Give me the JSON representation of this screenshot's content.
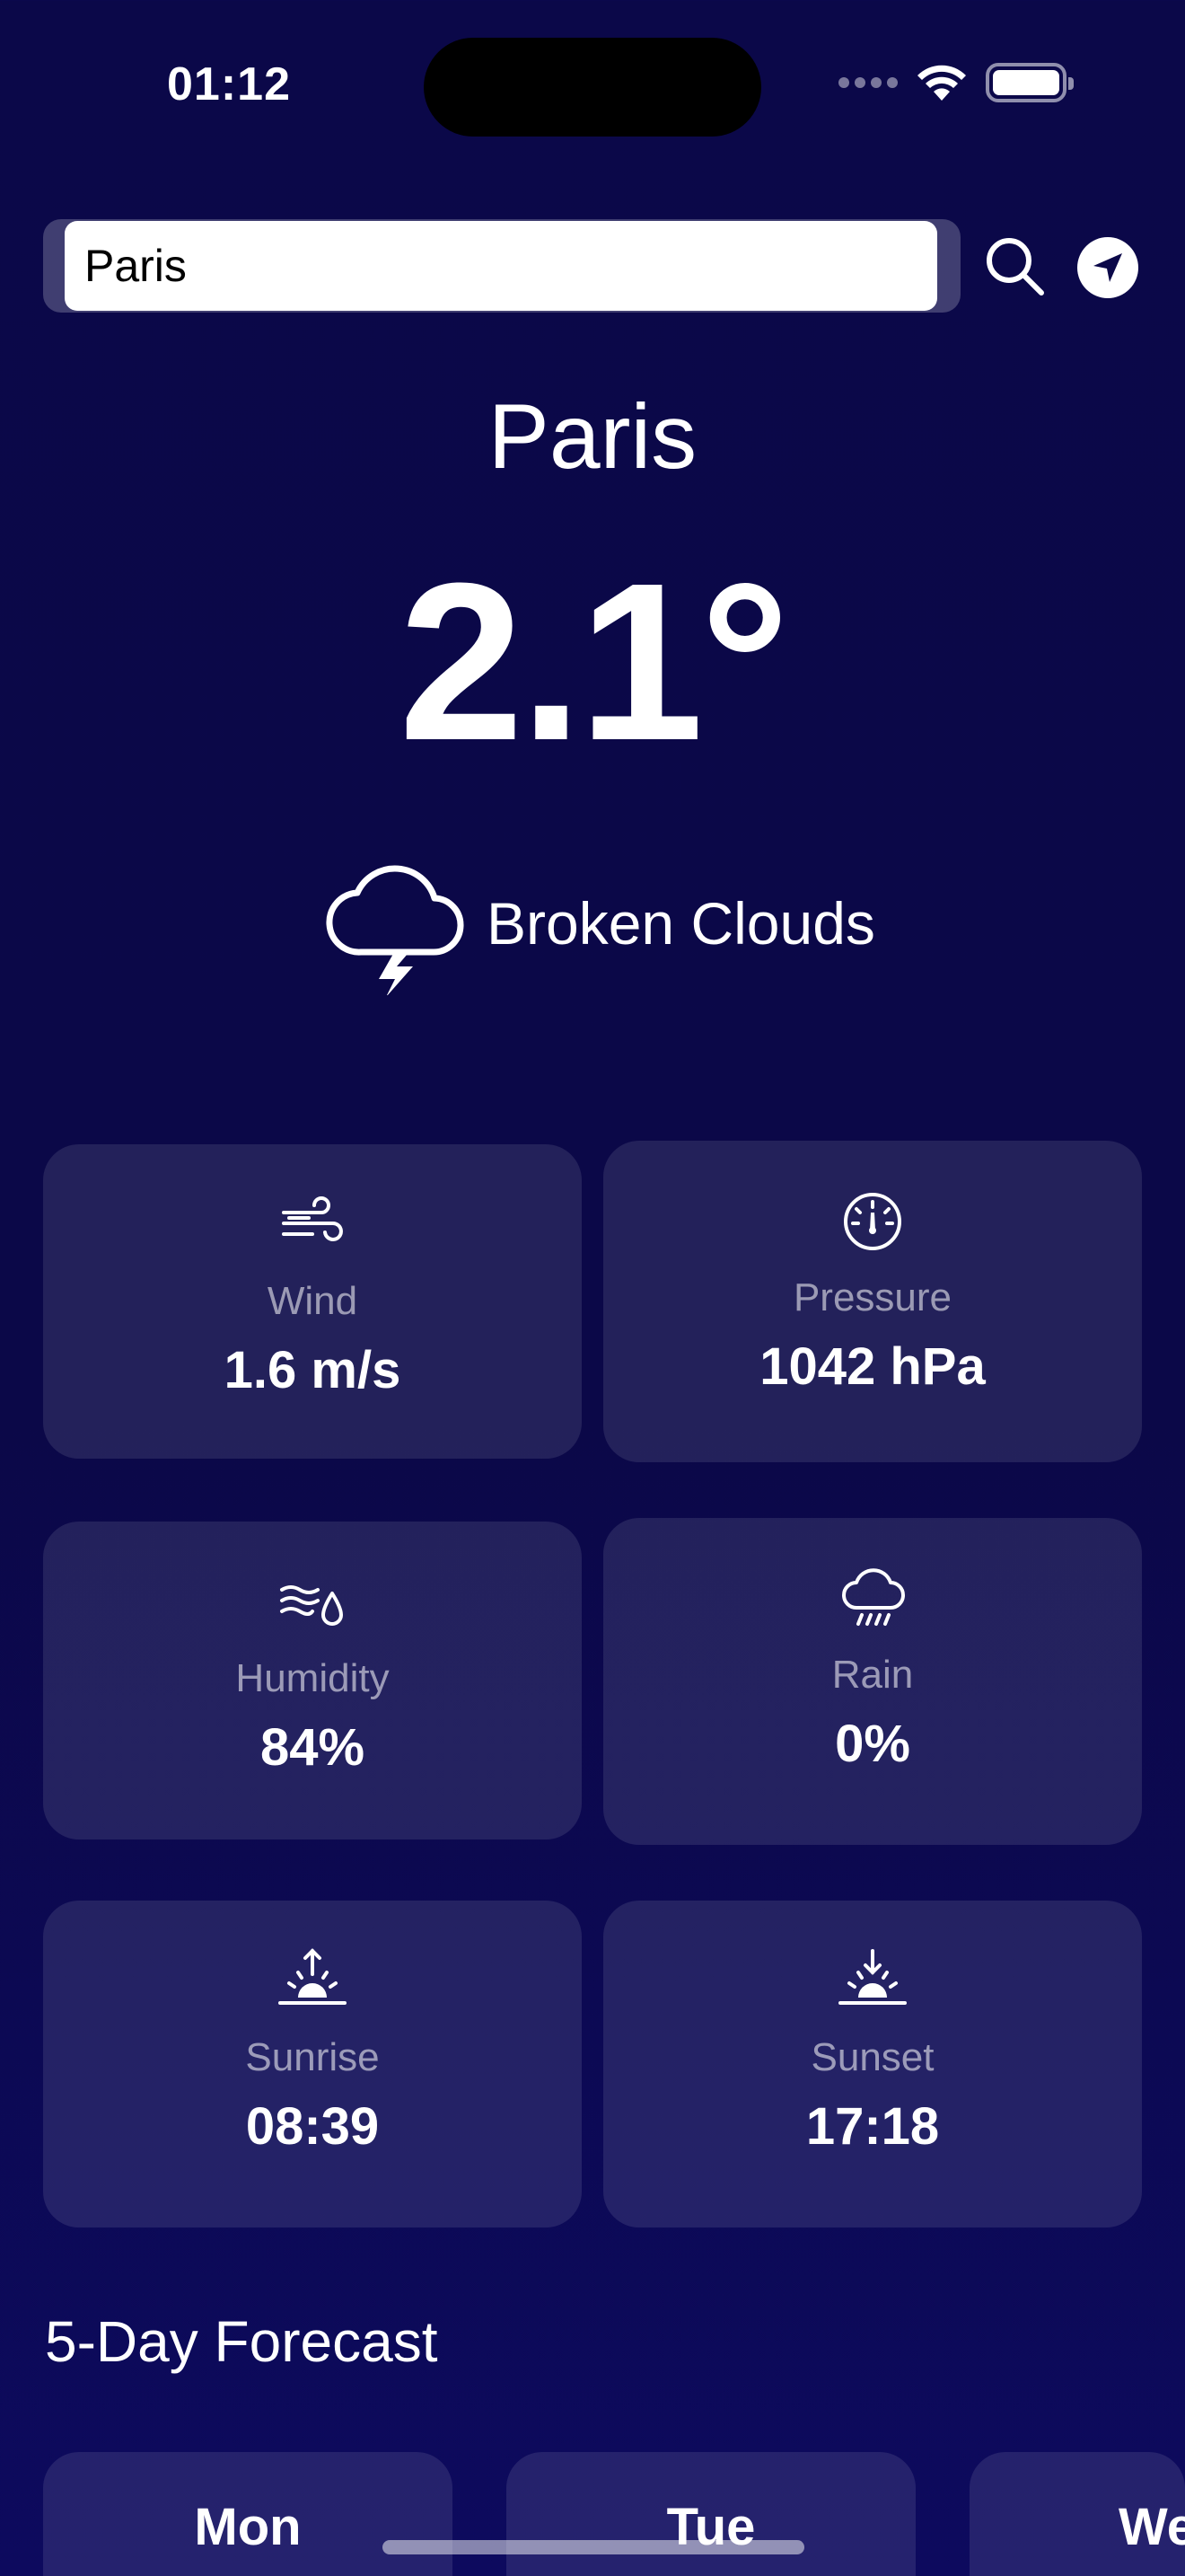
{
  "status_bar": {
    "time": "01:12"
  },
  "search": {
    "value": "Paris",
    "button": "search-icon",
    "location_button": "location-arrow-icon"
  },
  "current": {
    "city": "Paris",
    "temperature": "2.1°",
    "condition": "Broken Clouds",
    "condition_icon": "cloud-bolt-icon"
  },
  "stats": [
    {
      "icon": "wind-icon",
      "label": "Wind",
      "value": "1.6 m/s"
    },
    {
      "icon": "gauge-icon",
      "label": "Pressure",
      "value": "1042 hPa"
    },
    {
      "icon": "humidity-icon",
      "label": "Humidity",
      "value": "84%"
    },
    {
      "icon": "cloud-rain-icon",
      "label": "Rain",
      "value": "0%"
    },
    {
      "icon": "sunrise-icon",
      "label": "Sunrise",
      "value": "08:39"
    },
    {
      "icon": "sunset-icon",
      "label": "Sunset",
      "value": "17:18"
    }
  ],
  "forecast": {
    "title": "5-Day Forecast",
    "days": [
      {
        "day": "Mon"
      },
      {
        "day": "Tue"
      },
      {
        "day": "We"
      }
    ]
  },
  "colors": {
    "background": "#0b0849",
    "card": "rgba(255,255,255,0.10)",
    "text": "#ffffff"
  }
}
